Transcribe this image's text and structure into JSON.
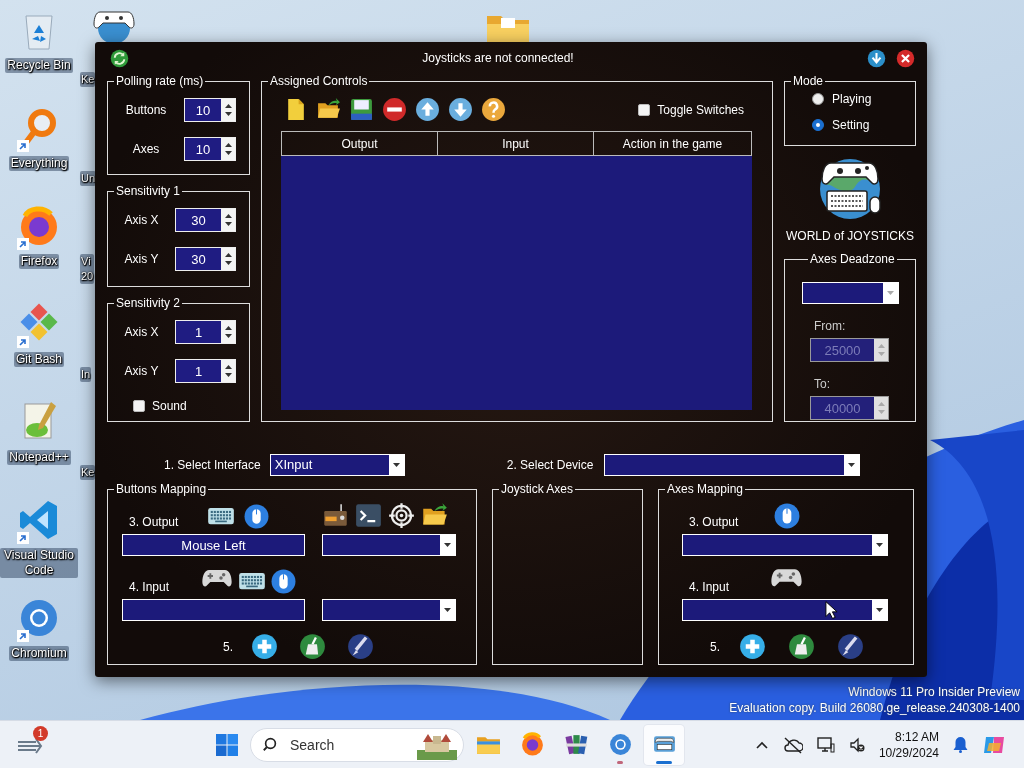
{
  "desktop": {
    "icons": [
      {
        "label": "Recycle Bin",
        "kind": "recycle",
        "shortcut": false
      },
      {
        "label": "Everything",
        "kind": "magnifier",
        "shortcut": true
      },
      {
        "label": "Firefox",
        "kind": "firefox",
        "shortcut": true
      },
      {
        "label": "Git Bash",
        "kind": "git",
        "shortcut": true
      },
      {
        "label": "Notepad++",
        "kind": "notepad",
        "shortcut": false
      },
      {
        "label": "Visual Studio Code",
        "kind": "vscode",
        "shortcut": true
      },
      {
        "label": "Chromium",
        "kind": "chromium",
        "shortcut": true
      }
    ],
    "covered_icons": [
      {
        "label": "Ke"
      },
      {
        "label": "Un"
      },
      {
        "label": "Vi 20"
      },
      {
        "label": "In"
      },
      {
        "label": "Ke"
      }
    ],
    "build_info": [
      "Windows 11 Pro Insider Preview",
      "Evaluation copy. Build 26080.ge_release.240308-1400"
    ]
  },
  "window": {
    "title": "Joysticks are not connected!",
    "polling_rate": {
      "legend": "Polling rate (ms)",
      "rows": [
        {
          "label": "Buttons",
          "value": "10"
        },
        {
          "label": "Axes",
          "value": "10"
        }
      ]
    },
    "sensitivity_1": {
      "legend": "Sensitivity 1",
      "rows": [
        {
          "label": "Axis X",
          "value": "30"
        },
        {
          "label": "Axis Y",
          "value": "30"
        }
      ]
    },
    "sensitivity_2": {
      "legend": "Sensitivity 2",
      "rows": [
        {
          "label": "Axis X",
          "value": "1"
        },
        {
          "label": "Axis Y",
          "value": "1"
        }
      ],
      "sound": {
        "label": "Sound",
        "checked": false
      }
    },
    "assigned_controls": {
      "legend": "Assigned Controls",
      "toggle_switches": {
        "label": "Toggle Switches",
        "checked": false
      },
      "table": {
        "columns": [
          "Output",
          "Input",
          "Action in the game"
        ]
      }
    },
    "mode": {
      "legend": "Mode",
      "options": [
        {
          "label": "Playing",
          "selected": false
        },
        {
          "label": "Setting",
          "selected": true
        }
      ]
    },
    "logo_caption": "WORLD of JOYSTICKS",
    "axes_deadzone": {
      "legend": "Axes Deadzone",
      "from": {
        "label": "From:",
        "value": "25000",
        "disabled": true
      },
      "to": {
        "label": "To:",
        "value": "40000",
        "disabled": true
      }
    },
    "select_interface": {
      "label": "1. Select Interface",
      "value": "XInput"
    },
    "select_device": {
      "label": "2. Select Device"
    },
    "buttons_mapping": {
      "legend": "Buttons Mapping",
      "output_label": "3. Output",
      "output_value": "Mouse Left",
      "input_label": "4. Input",
      "step_label": "5."
    },
    "joystick_axes": {
      "legend": "Joystick Axes"
    },
    "axes_mapping": {
      "legend": "Axes Mapping",
      "output_label": "3. Output",
      "input_label": "4. Input",
      "step_label": "5."
    }
  },
  "taskbar": {
    "notification_count": "1",
    "search_placeholder": "Search",
    "apps": [
      {
        "kind": "explorer",
        "running": false,
        "active": false
      },
      {
        "kind": "firefox",
        "running": false,
        "active": false
      },
      {
        "kind": "archive",
        "running": false,
        "active": false
      },
      {
        "kind": "chrome",
        "running": true,
        "active": false
      },
      {
        "kind": "joystick",
        "running": true,
        "active": true
      }
    ],
    "time": "8:12 AM",
    "date": "10/29/2024"
  }
}
